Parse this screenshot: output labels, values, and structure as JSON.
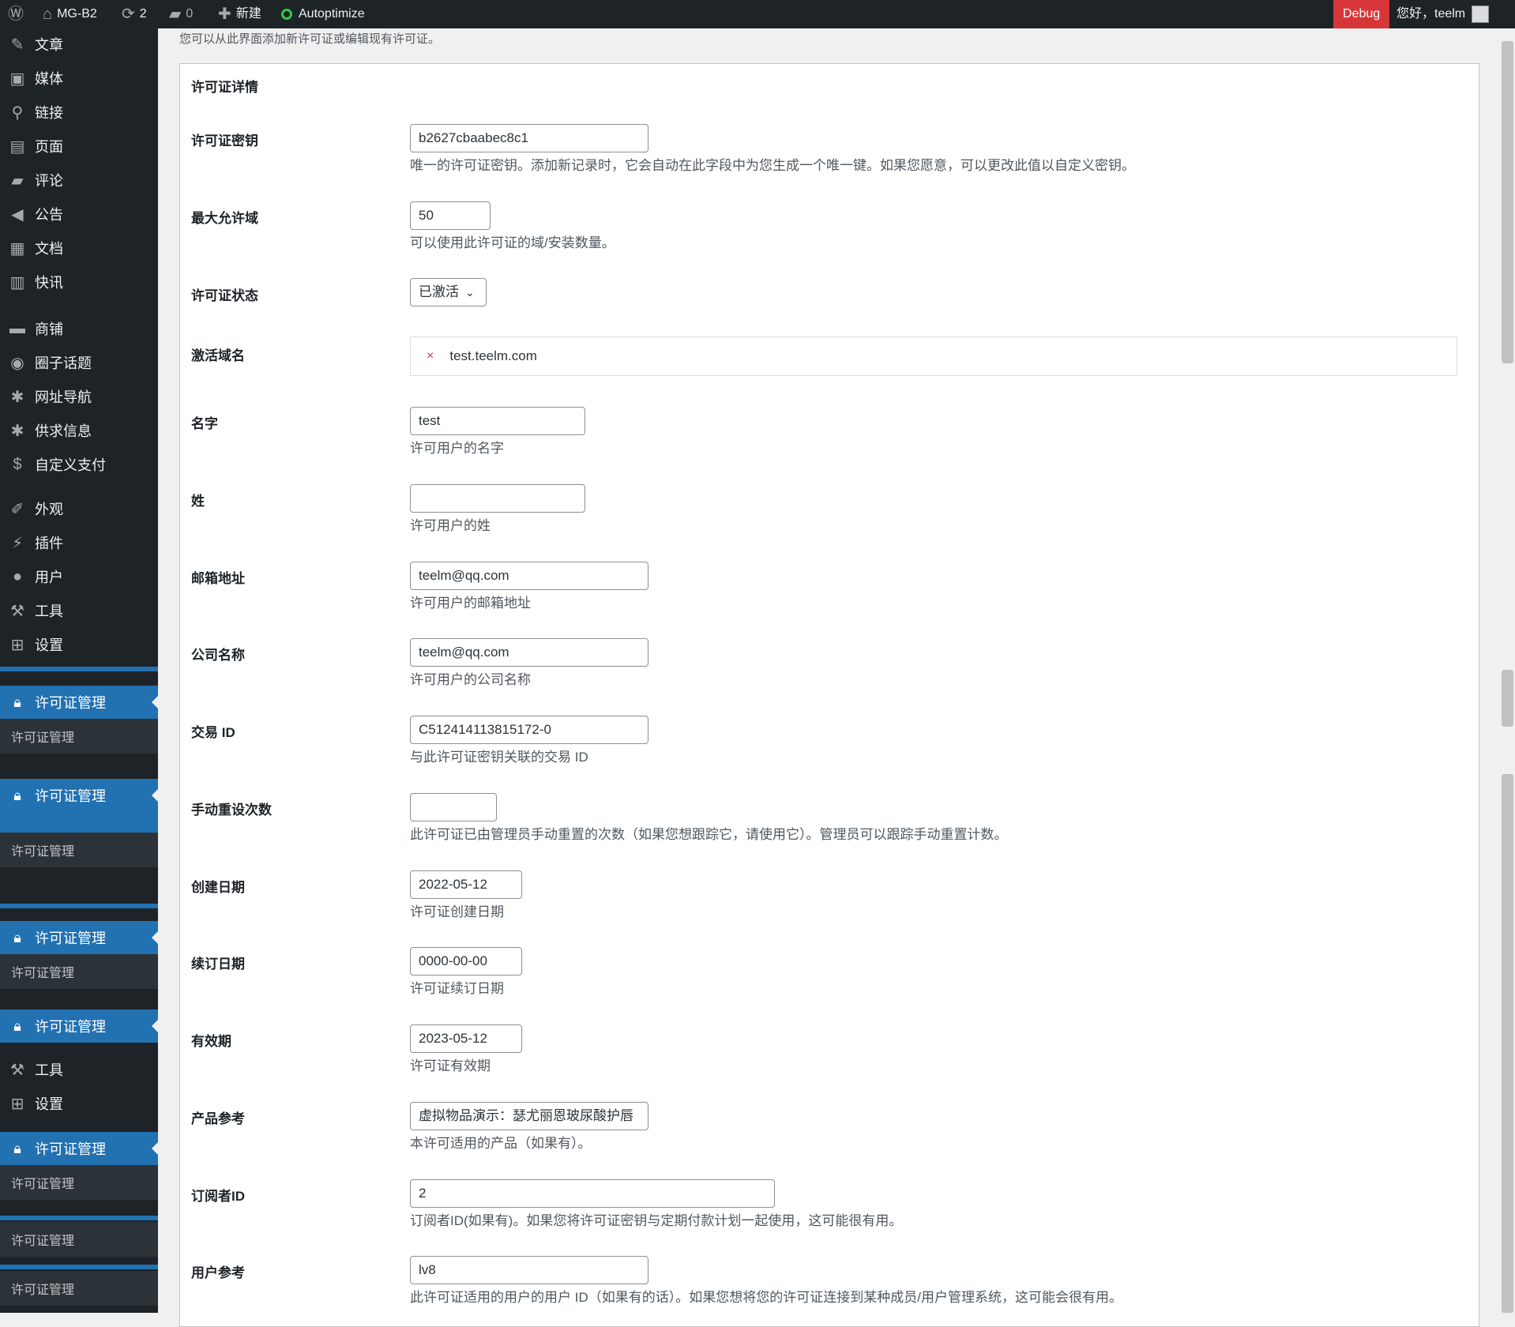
{
  "adminbar": {
    "site_name": "MG-B2",
    "updates_count": "2",
    "comments_count": "0",
    "new_label": "新建",
    "autoptimize_label": "Autoptimize",
    "debug_label": "Debug",
    "greeting": "您好，teelm"
  },
  "sidebar": {
    "items_top": [
      "文章",
      "媒体",
      "链接",
      "页面",
      "评论",
      "公告",
      "文档",
      "快讯"
    ],
    "items_mid": [
      "商铺",
      "圈子话题",
      "网址导航",
      "供求信息",
      "自定义支付"
    ],
    "items_bottom": [
      "外观",
      "插件",
      "用户",
      "工具",
      "设置"
    ],
    "license_menu": "许可证管理",
    "license_submenu": "许可证管理",
    "tools_label": "工具",
    "settings_label": "设置"
  },
  "page": {
    "intro": "您可以从此界面添加新许可证或编辑现有许可证。",
    "section_title": "许可证详情"
  },
  "form": {
    "license_key": {
      "label": "许可证密钥",
      "value": "b2627cbaabec8c1",
      "desc": "唯一的许可证密钥。添加新记录时，它会自动在此字段中为您生成一个唯一键。如果您愿意，可以更改此值以自定义密钥。"
    },
    "max_domains": {
      "label": "最大允许域",
      "value": "50",
      "desc": "可以使用此许可证的域/安装数量。"
    },
    "status": {
      "label": "许可证状态",
      "value": "已激活"
    },
    "domains": {
      "label": "激活域名",
      "items": [
        "test.teelm.com"
      ]
    },
    "first_name": {
      "label": "名字",
      "value": "test",
      "desc": "许可用户的名字"
    },
    "last_name": {
      "label": "姓",
      "value": "",
      "desc": "许可用户的姓"
    },
    "email": {
      "label": "邮箱地址",
      "value": "teelm@qq.com",
      "desc": "许可用户的邮箱地址"
    },
    "company": {
      "label": "公司名称",
      "value": "teelm@qq.com",
      "desc": "许可用户的公司名称"
    },
    "txn_id": {
      "label": "交易 ID",
      "value": "C512414113815172-0",
      "desc": "与此许可证密钥关联的交易 ID"
    },
    "manual_reset": {
      "label": "手动重设次数",
      "value": "",
      "desc": "此许可证已由管理员手动重置的次数（如果您想跟踪它，请使用它）。管理员可以跟踪手动重置计数。"
    },
    "created": {
      "label": "创建日期",
      "value": "2022-05-12",
      "desc": "许可证创建日期"
    },
    "renewed": {
      "label": "续订日期",
      "value": "0000-00-00",
      "desc": "许可证续订日期"
    },
    "expiry": {
      "label": "有效期",
      "value": "2023-05-12",
      "desc": "许可证有效期"
    },
    "product_ref": {
      "label": "产品参考",
      "value": "虚拟物品演示：瑟尤丽恩玻尿酸护唇",
      "desc": "本许可适用的产品（如果有）。"
    },
    "subscriber_id": {
      "label": "订阅者ID",
      "value": "2",
      "desc": "订阅者ID(如果有)。如果您将许可证密钥与定期付款计划一起使用，这可能很有用。"
    },
    "user_ref": {
      "label": "用户参考",
      "value": "lv8",
      "desc": "此许可证适用的用户的用户 ID（如果有的话）。如果您想将您的许可证连接到某种成员/用户管理系统，这可能会很有用。"
    }
  }
}
